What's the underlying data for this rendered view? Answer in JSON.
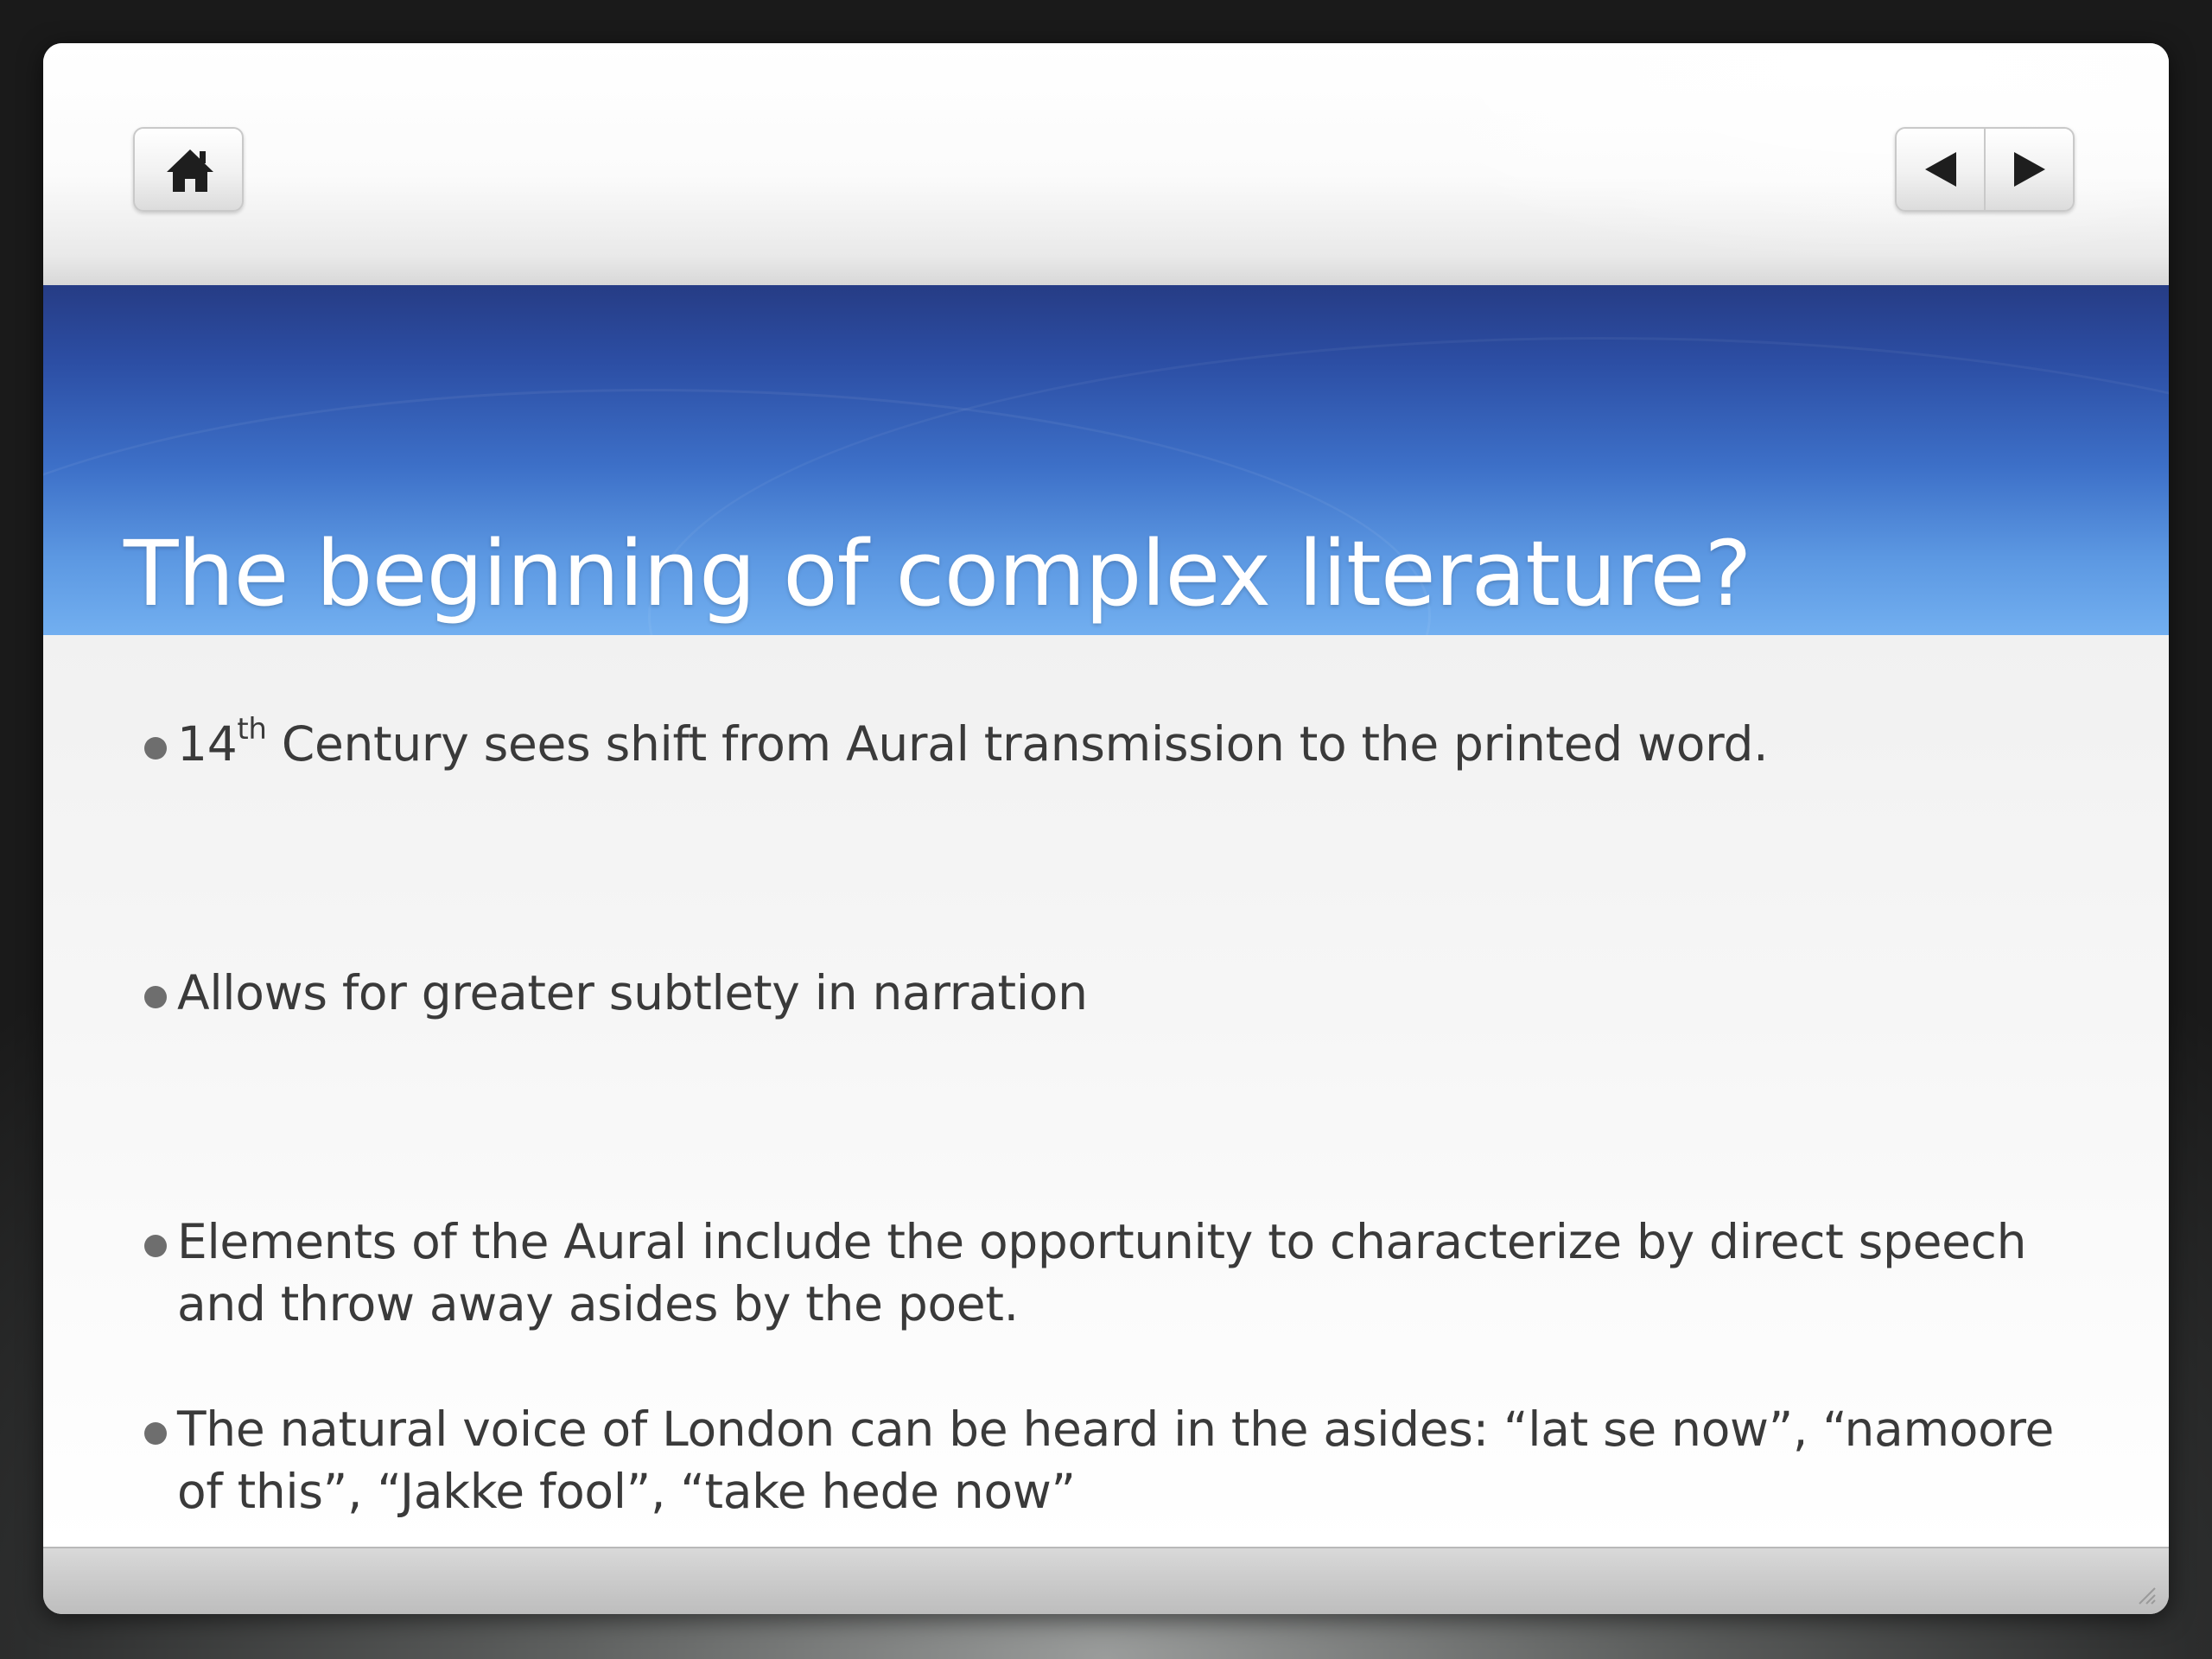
{
  "slide": {
    "title": "The beginning of complex literature?",
    "bullets": [
      {
        "number": "14",
        "superscript": "th",
        "text": " Century sees shift from Aural transmission to the printed word."
      },
      {
        "text": "Allows for greater subtlety in narration"
      },
      {
        "text": "Elements of the Aural include the opportunity to characterize by direct speech and throw away asides by the poet."
      },
      {
        "text": "The natural voice of London can be heard in the asides: “lat se now”, “namoore of this”, “Jakke fool”, “take hede now”"
      }
    ]
  },
  "navigation": {
    "home_icon": "home-icon",
    "previous_icon": "triangle-left-icon",
    "next_icon": "triangle-right-icon"
  },
  "colors": {
    "title_band_top": "#263c85",
    "title_band_bottom": "#72aff0",
    "title_text": "#ffffff",
    "body_text": "#3a3a3a",
    "bullet_dot": "#6e6e6e"
  }
}
